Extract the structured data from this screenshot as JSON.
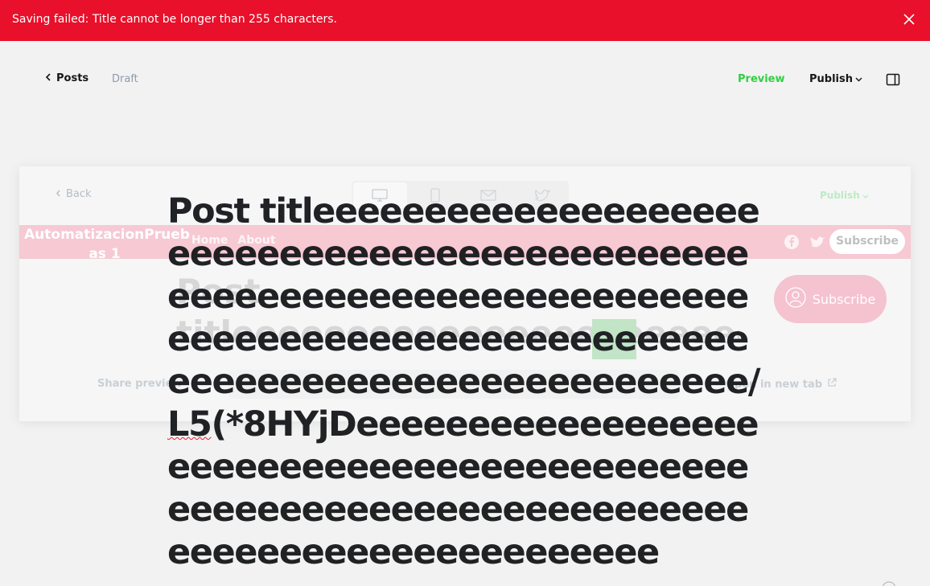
{
  "alert": {
    "message": "Saving failed: Title cannot be longer than 255 characters.",
    "close_icon": "close-icon"
  },
  "header": {
    "back_label": "Posts",
    "status": "Draft",
    "preview_label": "Preview",
    "publish_label": "Publish",
    "settings_icon": "sidebar-toggle-icon"
  },
  "preview_modal": {
    "back_label": "Back",
    "devices": [
      "desktop-icon",
      "mobile-icon",
      "email-icon",
      "twitter-icon"
    ],
    "publish_label": "Publish",
    "site_title": "AutomatizacionPrueb as 1",
    "nav": [
      "Home",
      "About"
    ],
    "subscribe_small": "Subscribe",
    "ghost_title": "Post titleeeeeeeeeeeeeeeeeeeeeeeeeeee",
    "subscribe_big": "Subscribe",
    "share_label": "Share preview",
    "newtab_label": "Open in new tab"
  },
  "post": {
    "title_part1": "Post titleeeeeeeeeeeeeeeeeeeeeeeeeeeeeeeeeeeeeeeeeeeeeeeeeeeeeeeeeeeeeeeeeeeeeeeeeeeeeeeeeeeeeeeeeee",
    "title_sel": "ee",
    "title_part2": "eeeeeeeeeeeeeeeeeeeeeeeeeeeeeee/",
    "title_squiggle": "L5",
    "title_part3": "(*8HYjDeeeeeeeeeeeeeeeeeeeeeeeeeeeeeeeeeeeeeeeeeeeeeeeeeeeeeeeeeeeeeeeeeeeeeeeeeeeeeeeeeeeeeeeeeeee"
  },
  "colors": {
    "error": "#e8102a",
    "preview_green": "#30cf43",
    "accent_pink": "#f6c9d3"
  }
}
